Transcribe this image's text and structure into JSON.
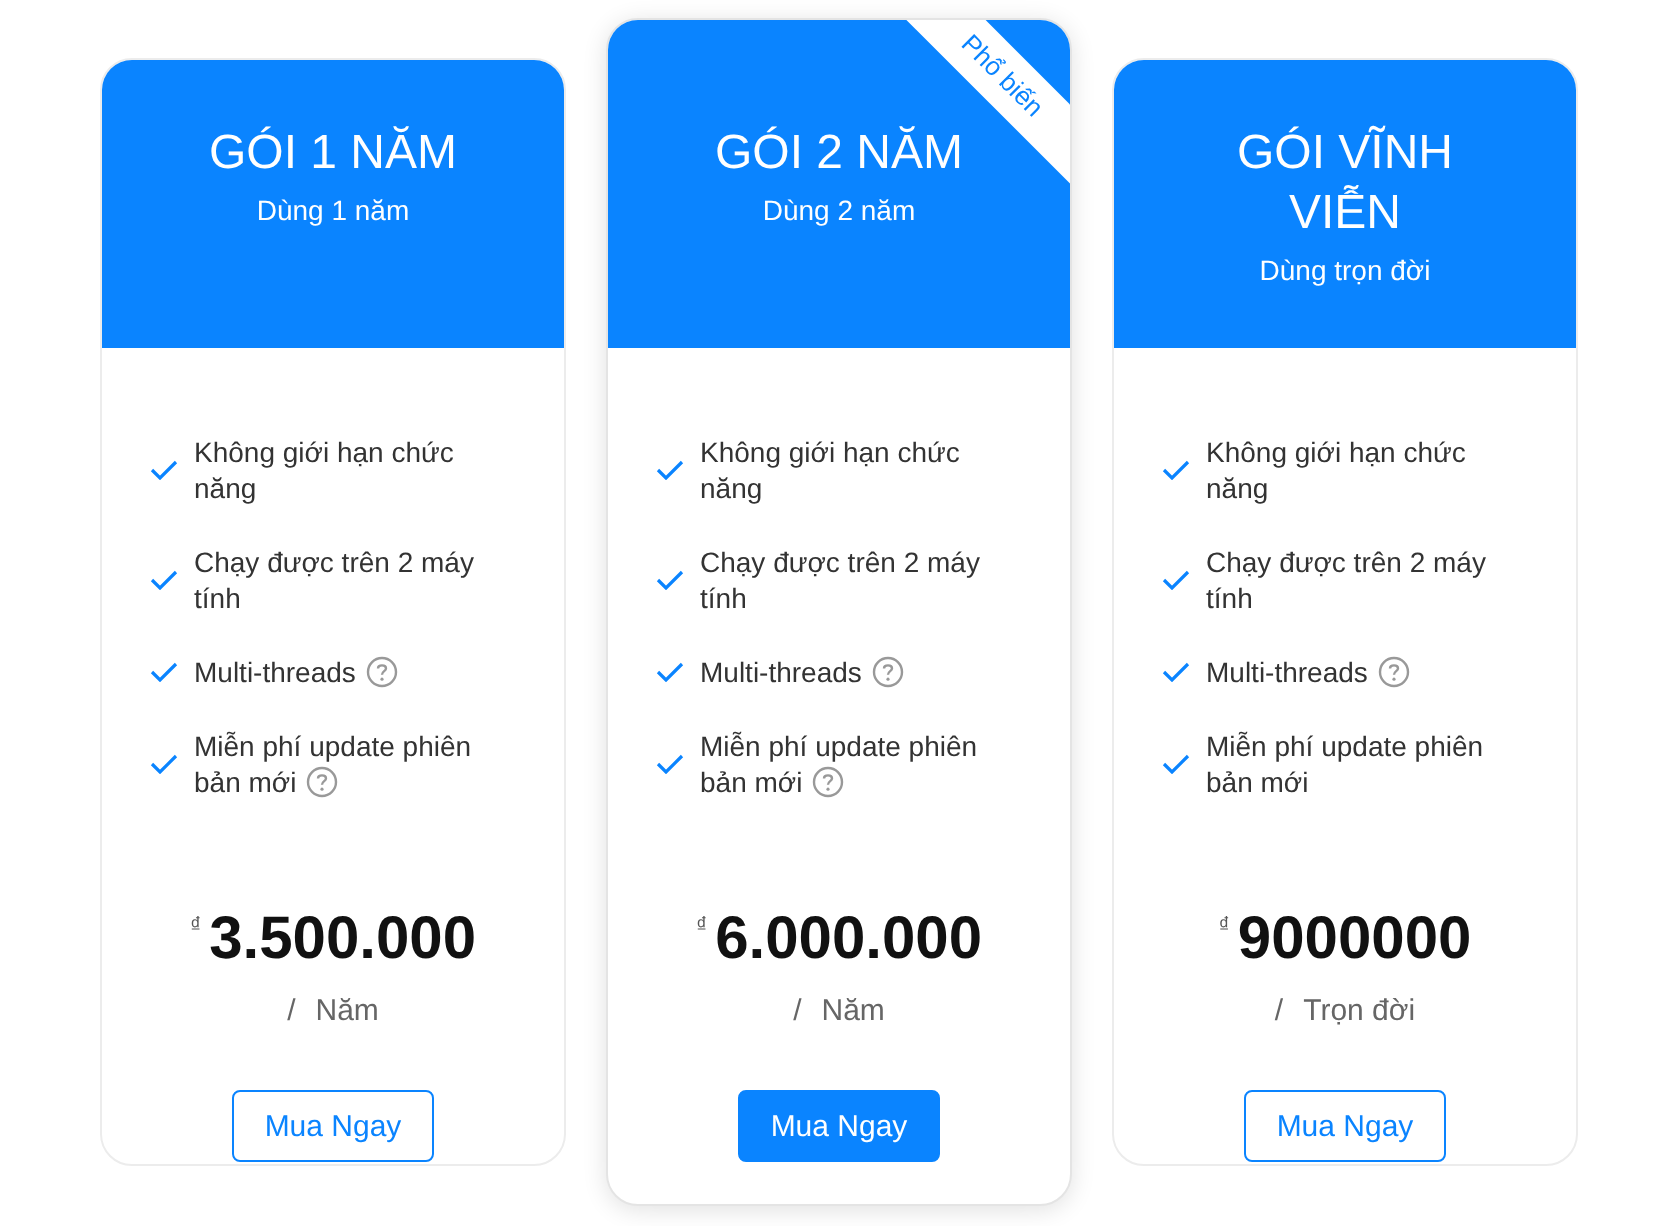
{
  "plans": [
    {
      "title": "GÓI 1 NĂM",
      "subtitle": "Dùng 1 năm",
      "featured": false,
      "features": [
        {
          "text": "Không giới hạn chức năng",
          "help": false
        },
        {
          "text": "Chạy được trên 2 máy tính",
          "help": false
        },
        {
          "text": "Multi-threads",
          "help": true
        },
        {
          "text": "Miễn phí update phiên bản mới",
          "help": true
        }
      ],
      "currency": "₫",
      "price": "3.500.000",
      "separator": "/",
      "period": "Năm",
      "button": "Mua Ngay"
    },
    {
      "title": "GÓI 2 NĂM",
      "subtitle": "Dùng 2 năm",
      "featured": true,
      "ribbon": "Phổ biến",
      "features": [
        {
          "text": "Không giới hạn chức năng",
          "help": false
        },
        {
          "text": "Chạy được trên 2 máy tính",
          "help": false
        },
        {
          "text": "Multi-threads",
          "help": true
        },
        {
          "text": "Miễn phí update phiên bản mới",
          "help": true
        }
      ],
      "currency": "₫",
      "price": "6.000.000",
      "separator": "/",
      "period": "Năm",
      "button": "Mua Ngay"
    },
    {
      "title": "GÓI VĨNH VIỄN",
      "subtitle": "Dùng trọn đời",
      "featured": false,
      "features": [
        {
          "text": "Không giới hạn chức năng",
          "help": false
        },
        {
          "text": "Chạy được trên 2 máy tính",
          "help": false
        },
        {
          "text": "Multi-threads",
          "help": true
        },
        {
          "text": "Miễn phí update phiên bản mới",
          "help": false
        }
      ],
      "currency": "₫",
      "price": "9000000",
      "separator": "/",
      "period": "Trọn đời",
      "button": "Mua Ngay"
    }
  ]
}
